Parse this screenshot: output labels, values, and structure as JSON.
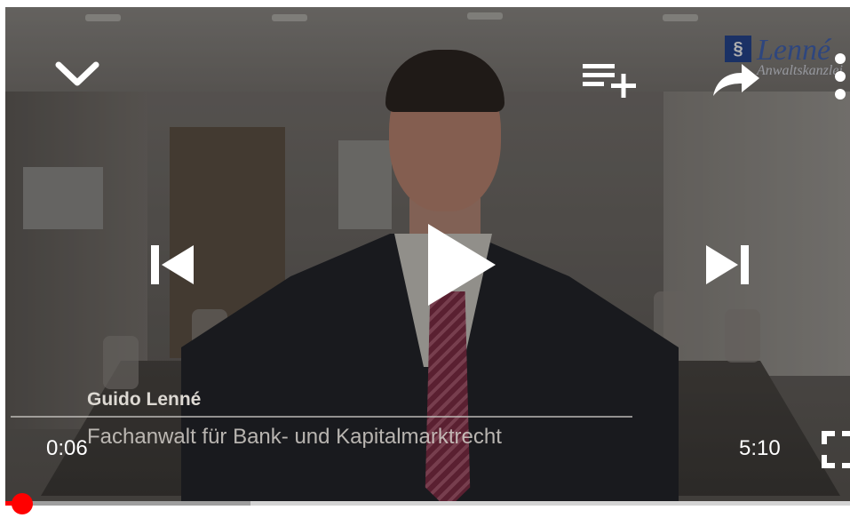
{
  "player": {
    "overlay_name": "Guido Lenné",
    "overlay_title": "Fachanwalt für Bank- und Kapitalmarktrecht",
    "logo_name": "Lenné",
    "logo_sub": "Anwaltskanzlei",
    "logo_mark": "§",
    "current_time": "0:06",
    "total_time": "5:10",
    "progress": 0.02,
    "buffered": 0.29,
    "accent_color": "#ff0000"
  },
  "icons": {
    "minimize": "chevron-down-icon",
    "add_to_queue": "add-to-queue-icon",
    "share": "share-icon",
    "more": "more-vert-icon",
    "previous": "skip-previous-icon",
    "play": "play-icon",
    "next": "skip-next-icon",
    "fullscreen": "fullscreen-icon"
  }
}
